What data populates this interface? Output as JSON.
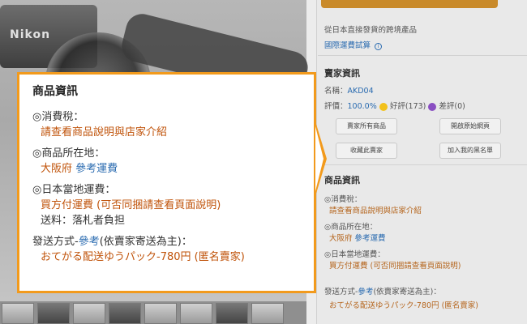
{
  "photo": {
    "brand": "Nikon",
    "thumb_count": 9
  },
  "sidebar": {
    "cross_border": "從日本直接發貨的跨境產品",
    "shipping_calc": "國際運費試算",
    "seller_heading": "賣家資訊",
    "seller_name_label": "名稱：",
    "seller_name": "AKD04",
    "rating_label": "評價：",
    "rating_percent": "100.0%",
    "good_label": "好評(173)",
    "bad_label": "差評(0)",
    "buttons": [
      "賣家所有商品",
      "開啟原始網頁",
      "收藏此賣家",
      "加入我的黑名單"
    ],
    "product_heading": "商品資訊",
    "tax_label": "◎消費稅：",
    "tax_value": "請查看商品說明與店家介紹",
    "location_label": "◎商品所在地：",
    "location_value": "大阪府",
    "location_link": "參考運費",
    "domestic_label": "◎日本當地運費：",
    "domestic_value": "買方付運費 (可否同捆請查看頁面說明)",
    "send_label": "發送方式-",
    "send_link": "參考",
    "send_note": "(依賣家寄送為主)：",
    "send_value": "おてがる配送ゆうパック-780円 (匿名賣家)"
  },
  "popup": {
    "title": "商品資訊",
    "tax_label": "◎消費稅：",
    "tax_value": "請查看商品說明與店家介紹",
    "location_label": "◎商品所在地：",
    "location_value": "大阪府",
    "location_link": "參考運費",
    "domestic_label": "◎日本當地運費：",
    "domestic_value": "買方付運費 (可否同捆請查看頁面說明)",
    "domestic_extra": "送料：落札者負担",
    "send_label": "發送方式-",
    "send_link": "參考",
    "send_note": "(依賣家寄送為主)：",
    "send_value": "おてがる配送ゆうパック-780円 (匿名賣家)"
  },
  "colors": {
    "accent": "#f29a1c",
    "value_text": "#c0530a",
    "link": "#2a6bb0"
  }
}
